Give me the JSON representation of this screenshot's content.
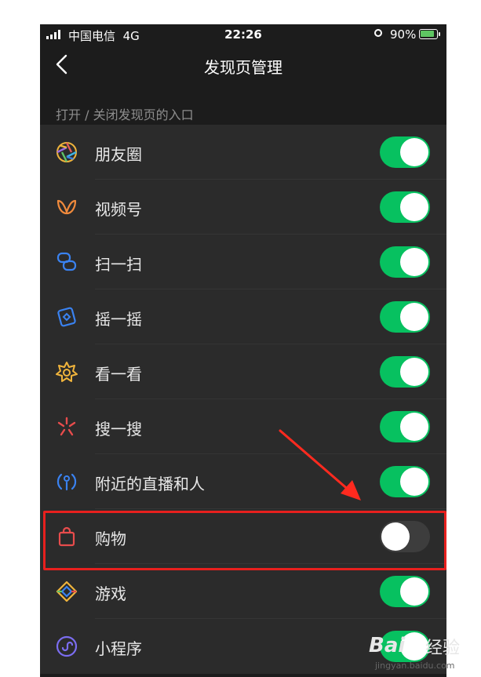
{
  "status_bar": {
    "carrier": "中国电信",
    "network": "4G",
    "time": "22:26",
    "battery_percent": "90%"
  },
  "nav": {
    "title": "发现页管理"
  },
  "section_caption": "打开 / 关闭发现页的入口",
  "items": [
    {
      "label": "朋友圈",
      "icon": "moments-icon",
      "enabled": true
    },
    {
      "label": "视频号",
      "icon": "channels-icon",
      "enabled": true
    },
    {
      "label": "扫一扫",
      "icon": "scan-icon",
      "enabled": true
    },
    {
      "label": "摇一摇",
      "icon": "shake-icon",
      "enabled": true
    },
    {
      "label": "看一看",
      "icon": "top-stories-icon",
      "enabled": true
    },
    {
      "label": "搜一搜",
      "icon": "search-icon",
      "enabled": true
    },
    {
      "label": "附近的直播和人",
      "icon": "nearby-icon",
      "enabled": true
    },
    {
      "label": "购物",
      "icon": "shopping-bag-icon",
      "enabled": false
    },
    {
      "label": "游戏",
      "icon": "games-icon",
      "enabled": true
    },
    {
      "label": "小程序",
      "icon": "mini-programs-icon",
      "enabled": true
    }
  ],
  "colors": {
    "toggle_on": "#07c160",
    "highlight": "#e8201e"
  },
  "watermark": {
    "logo": "Bai",
    "logo_cn": "经验",
    "url": "jingyan.baidu.com"
  }
}
